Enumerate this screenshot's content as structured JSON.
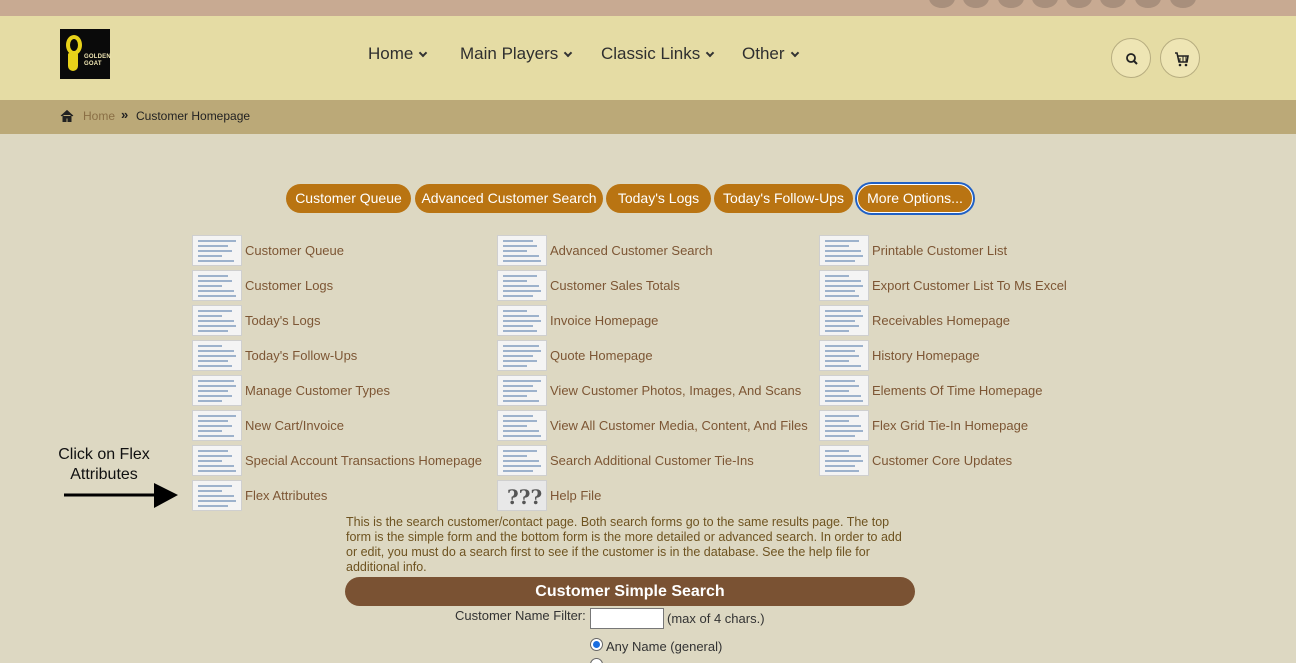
{
  "logo": {
    "line1": "GOLDEN",
    "line2": "GOAT"
  },
  "nav": [
    {
      "label": "Home"
    },
    {
      "label": "Main Players"
    },
    {
      "label": "Classic Links"
    },
    {
      "label": "Other"
    }
  ],
  "icons": {
    "search": "search-icon",
    "cart": "cart-icon",
    "home": "home-icon"
  },
  "breadcrumb": {
    "home": "Home",
    "separator": "»",
    "current": "Customer Homepage"
  },
  "buttons": [
    {
      "label": "Customer Queue"
    },
    {
      "label": "Advanced Customer Search"
    },
    {
      "label": "Today's Logs"
    },
    {
      "label": "Today's Follow-Ups"
    },
    {
      "label": "More Options..."
    }
  ],
  "links": [
    [
      "Customer Queue",
      "Customer Logs",
      "Today's Logs",
      "Today's Follow-Ups",
      "Manage Customer Types",
      "New Cart/Invoice",
      "Special Account Transactions Homepage",
      "Flex Attributes"
    ],
    [
      "Advanced Customer Search",
      "Customer Sales Totals",
      "Invoice Homepage",
      "Quote Homepage",
      "View Customer Photos, Images, And Scans",
      "View All Customer Media, Content, And Files",
      "Search Additional Customer Tie-Ins",
      "Help File"
    ],
    [
      "Printable Customer List",
      "Export Customer List To Ms Excel",
      "Receivables Homepage",
      "History Homepage",
      "Elements Of Time Homepage",
      "Flex Grid Tie-In Homepage",
      "Customer Core Updates"
    ]
  ],
  "help_icon_text": "???",
  "annotation": {
    "line1": "Click on Flex",
    "line2": "Attributes"
  },
  "description": "This is the search customer/contact page. Both search forms go to the same results page. The top form is the simple form and the bottom form is the more detailed or advanced search. In order to add or edit, you must do a search first to see if the customer is in the database. See the help file for additional info.",
  "simple_search": {
    "title": "Customer Simple Search",
    "filter_label": "Customer Name Filter:",
    "filter_value": "",
    "filter_note": "(max of 4 chars.)",
    "radio_any": "Any Name (general)"
  },
  "colors": {
    "header": "#e5dca4",
    "breadcrumb": "#bba978",
    "button": "#b97412",
    "search_bar": "#7a5233",
    "link": "#7d5634",
    "page": "#ddd8c2"
  }
}
